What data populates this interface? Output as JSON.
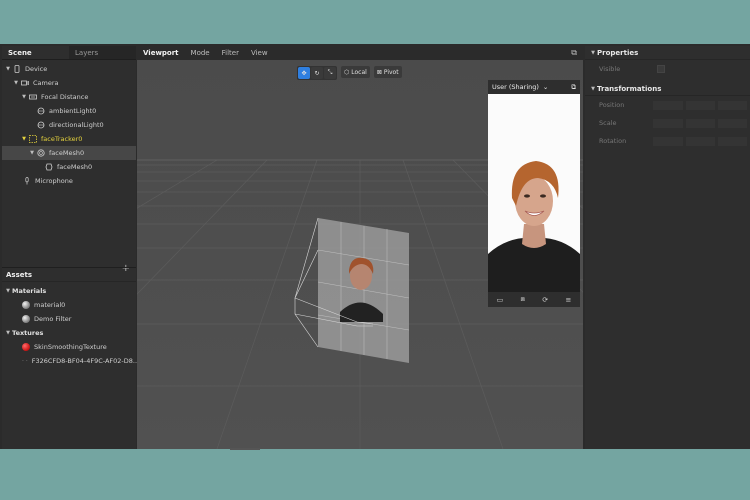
{
  "left_tabs": {
    "scene": "Scene",
    "layers": "Layers"
  },
  "tree": {
    "device": "Device",
    "camera": "Camera",
    "focal_distance": "Focal Distance",
    "ambient_light": "ambientLight0",
    "directional_light": "directionalLight0",
    "face_tracker": "faceTracker0",
    "face_mesh_group": "faceMesh0",
    "face_mesh": "faceMesh0",
    "microphone": "Microphone"
  },
  "assets": {
    "title": "Assets",
    "materials_label": "Materials",
    "material0": "material0",
    "demo_filter": "Demo Filter",
    "textures_label": "Textures",
    "skin_texture": "SkinSmoothingTexture",
    "hash_texture": "F326CFD8-BF04-4F9C-AF02-D8..."
  },
  "center_tabs": {
    "viewport": "Viewport",
    "mode": "Mode",
    "filter": "Filter",
    "view": "View"
  },
  "toolbar": {
    "local": "Local",
    "pivot": "Pivot"
  },
  "preview": {
    "user": "User (Sharing)"
  },
  "properties": {
    "title": "Properties",
    "visible": "Visible",
    "transformations": "Transformations",
    "position": "Position",
    "scale": "Scale",
    "rotation": "Rotation"
  },
  "colors": {
    "selected_yellow": "#e5d33d",
    "accent_blue": "#2f7fe0",
    "texture_red": "#d21c1c"
  }
}
